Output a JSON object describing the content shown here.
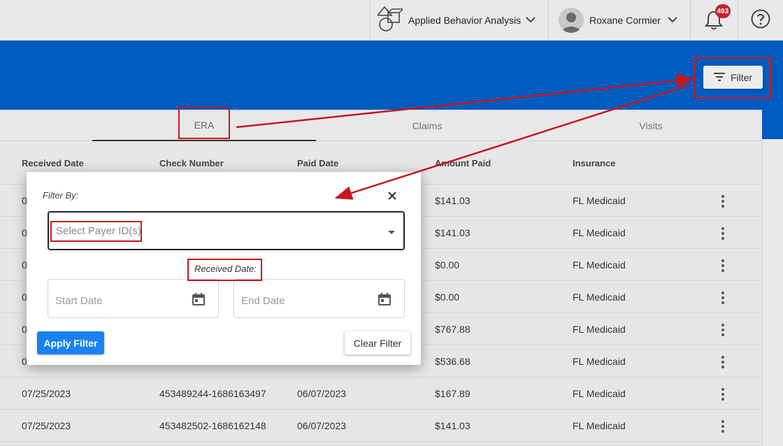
{
  "topbar": {
    "organization": "Applied Behavior Analysis",
    "user_name": "Roxane Cormier",
    "notification_count": "493"
  },
  "toolbar": {
    "filter_label": "Filter"
  },
  "tabs": [
    {
      "label": "ERA",
      "active": true
    },
    {
      "label": "Claims",
      "active": false
    },
    {
      "label": "Visits",
      "active": false
    }
  ],
  "table": {
    "headers": [
      "Received Date",
      "Check Number",
      "Paid Date",
      "Amount Paid",
      "Insurance"
    ],
    "rows": [
      {
        "received_partial": "0",
        "amount": "$141.03",
        "insurance": "FL Medicaid"
      },
      {
        "received_partial": "0",
        "amount": "$141.03",
        "insurance": "FL Medicaid"
      },
      {
        "received_partial": "0",
        "amount": "$0.00",
        "insurance": "FL Medicaid"
      },
      {
        "received_partial": "0",
        "amount": "$0.00",
        "insurance": "FL Medicaid"
      },
      {
        "received_partial": "0",
        "amount": "$767.88",
        "insurance": "FL Medicaid"
      },
      {
        "received_partial": "0",
        "amount": "$536.68",
        "insurance": "FL Medicaid"
      },
      {
        "received": "07/25/2023",
        "check": "453489244-1686163497",
        "paid": "06/07/2023",
        "amount": "$167.89",
        "insurance": "FL Medicaid"
      },
      {
        "received": "07/25/2023",
        "check": "453482502-1686162148",
        "paid": "06/07/2023",
        "amount": "$141.03",
        "insurance": "FL Medicaid"
      }
    ]
  },
  "modal": {
    "title": "Filter By:",
    "payer_placeholder": "Select Payer ID(s)",
    "received_date_label": "Received Date:",
    "start_date_placeholder": "Start Date",
    "end_date_placeholder": "End Date",
    "apply_label": "Apply Filter",
    "clear_label": "Clear Filter"
  },
  "colors": {
    "primary_blue": "#005bbf",
    "apply_button": "#1a82f0",
    "badge_red": "#c0262d",
    "annotation_red": "#c8161d"
  },
  "icons": [
    "org-logo-icon",
    "chevron-down-icon",
    "avatar-icon",
    "bell-icon",
    "help-icon",
    "filter-icon",
    "close-icon",
    "calendar-icon",
    "kebab-menu-icon"
  ]
}
